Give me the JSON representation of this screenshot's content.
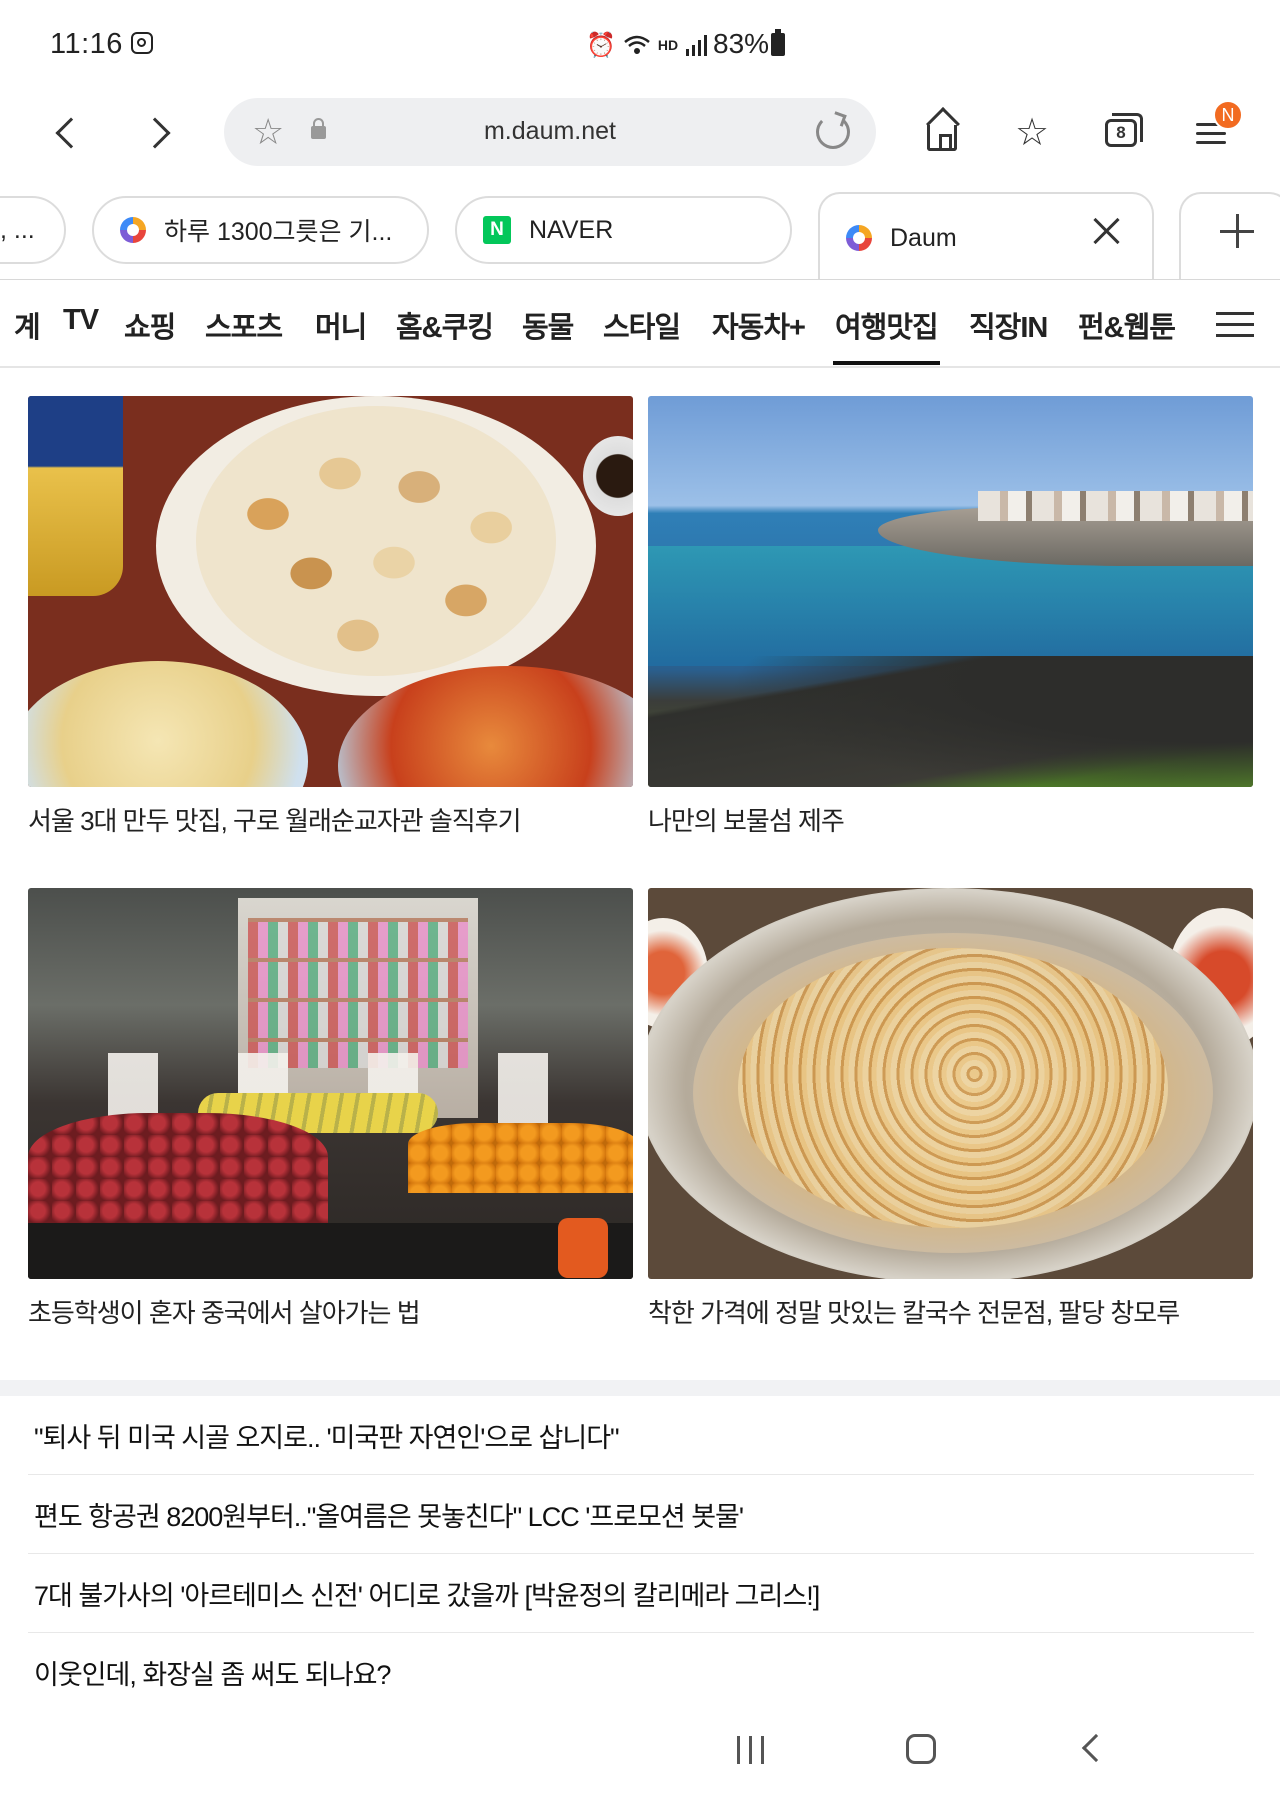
{
  "status_bar": {
    "time": "11:16",
    "battery": "83%",
    "icons": [
      "instagram-icon",
      "alarm-icon",
      "wifi-icon",
      "hd-voice-icon",
      "signal-icon",
      "battery-icon"
    ],
    "hd_label": "HD"
  },
  "toolbar": {
    "url": "m.daum.net",
    "tab_count": "8",
    "notification_badge": "N"
  },
  "tabs": [
    {
      "title": ", ...",
      "active": false
    },
    {
      "title": "하루 1300그릇은 기...",
      "active": false,
      "favicon": "daum"
    },
    {
      "title": "NAVER",
      "active": false,
      "favicon": "naver",
      "favicon_letter": "N"
    },
    {
      "title": "Daum",
      "active": true,
      "favicon": "daum"
    }
  ],
  "categories": {
    "items": [
      "계",
      "TV",
      "쇼핑",
      "스포츠",
      "머니",
      "홈&쿠킹",
      "동물",
      "스타일",
      "자동차+",
      "여행맛집",
      "직장IN",
      "펀&웹툰"
    ],
    "active": "여행맛집"
  },
  "cards": [
    {
      "title": "서울 3대 만두 맛집, 구로 월래순교자관 솔직후기",
      "image": "fried-dumplings-photo"
    },
    {
      "title": "나만의 보물섬 제주",
      "image": "jeju-coast-photo"
    },
    {
      "title": "초등학생이 혼자 중국에서 살아가는 법",
      "image": "market-stall-photo"
    },
    {
      "title": "착한 가격에 정말 맛있는 칼국수 전문점, 팔당 창모루",
      "image": "kalguksu-pot-photo"
    }
  ],
  "headlines": [
    "\"퇴사 뒤 미국 시골 오지로.. '미국판 자연인'으로 삽니다\"",
    "편도 항공권 8200원부터..\"올여름은 못놓친다\" LCC '프로모션 봇물'",
    "7대 불가사의 '아르테미스 신전' 어디로 갔을까 [박윤정의 칼리메라 그리스!]",
    "이웃인데, 화장실 좀 써도 되나요?"
  ],
  "colors": {
    "badge": "#f26b21",
    "naver": "#03c75a",
    "url_bar_bg": "#eeeff1"
  }
}
